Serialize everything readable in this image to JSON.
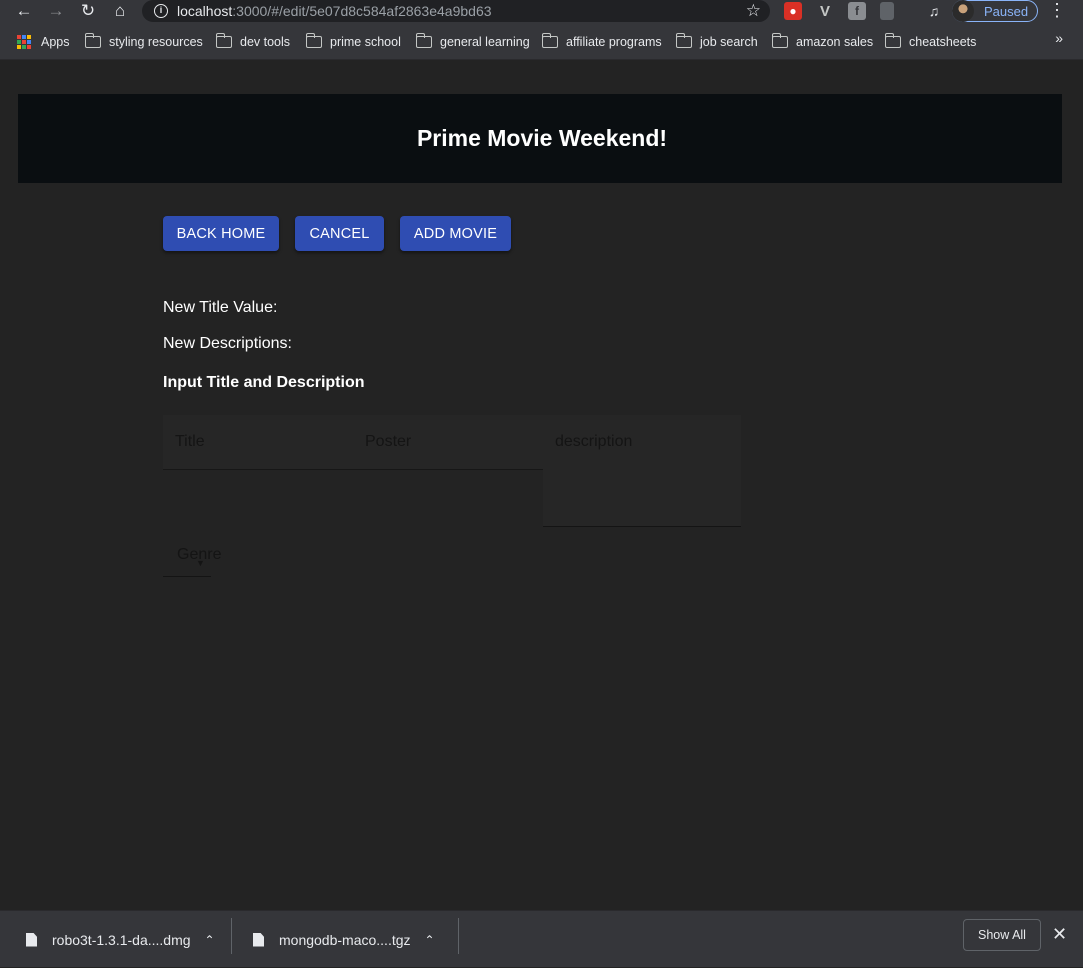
{
  "browser": {
    "url_host": "localhost",
    "url_rest": ":3000/#/edit/5e07d8c584af2863e4a9bd63",
    "profile_label": "Paused",
    "bookmarks": [
      {
        "label": "Apps"
      },
      {
        "label": "styling resources"
      },
      {
        "label": "dev tools"
      },
      {
        "label": "prime school"
      },
      {
        "label": "general learning"
      },
      {
        "label": "affiliate programs"
      },
      {
        "label": "job search"
      },
      {
        "label": "amazon sales"
      },
      {
        "label": "cheatsheets"
      }
    ],
    "more_glyph": "»"
  },
  "page": {
    "header_title": "Prime Movie Weekend!",
    "buttons": {
      "back_home": "Back Home",
      "cancel": "Cancel",
      "add_movie": "Add Movie"
    },
    "new_title_label": "New Title Value:",
    "new_desc_label": "New Descriptions:",
    "section_title": "Input Title and Description",
    "fields": {
      "title_placeholder": "Title",
      "poster_placeholder": "Poster",
      "description_placeholder": "description",
      "genre_label": "Genre"
    }
  },
  "downloads": {
    "items": [
      {
        "name": "robo3t-1.3.1-da....dmg"
      },
      {
        "name": "mongodb-maco....tgz"
      }
    ],
    "show_all": "Show All"
  },
  "colors": {
    "page_bg": "#232323",
    "header_bg": "#0a0e11",
    "button_bg": "#2f4db2",
    "chrome_bg": "#35363a",
    "profile_accent": "#8ab4f8"
  }
}
